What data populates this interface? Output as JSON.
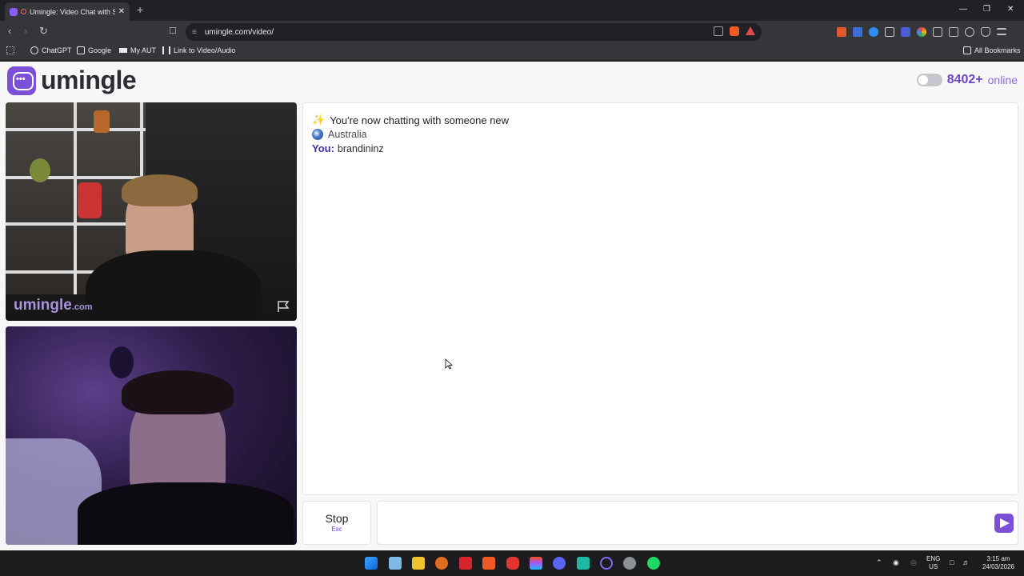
{
  "browser": {
    "tab_title": "Umingle: Video Chat with Strangers",
    "new_tab": "+",
    "close_tab": "✕",
    "window_controls": [
      "—",
      "❐",
      "✕"
    ],
    "url": "umingle.com/video/",
    "bookmarks": [
      "ChatGPT",
      "Google",
      "My AUT",
      "Link to Video/Audio"
    ],
    "all_bookmarks": "All Bookmarks"
  },
  "header": {
    "logo_text": "umingle",
    "online_count": "8402+",
    "online_label": "online"
  },
  "videos": {
    "watermark_main": "umingle",
    "watermark_suffix": ".com"
  },
  "chat": {
    "intro": "You're now chatting with someone new",
    "country": "Australia",
    "you_label": "You:",
    "you_name": "brandininz"
  },
  "controls": {
    "stop_label": "Stop",
    "stop_key": "Esc",
    "message_placeholder": ""
  },
  "taskbar": {
    "lang_top": "ENG",
    "lang_bottom": "US",
    "time": "3:15 am",
    "date": "24/03/2026"
  },
  "colors": {
    "brand": "#7c4fd8",
    "online": "#6b46c1",
    "you_label": "#3b2ea8"
  }
}
